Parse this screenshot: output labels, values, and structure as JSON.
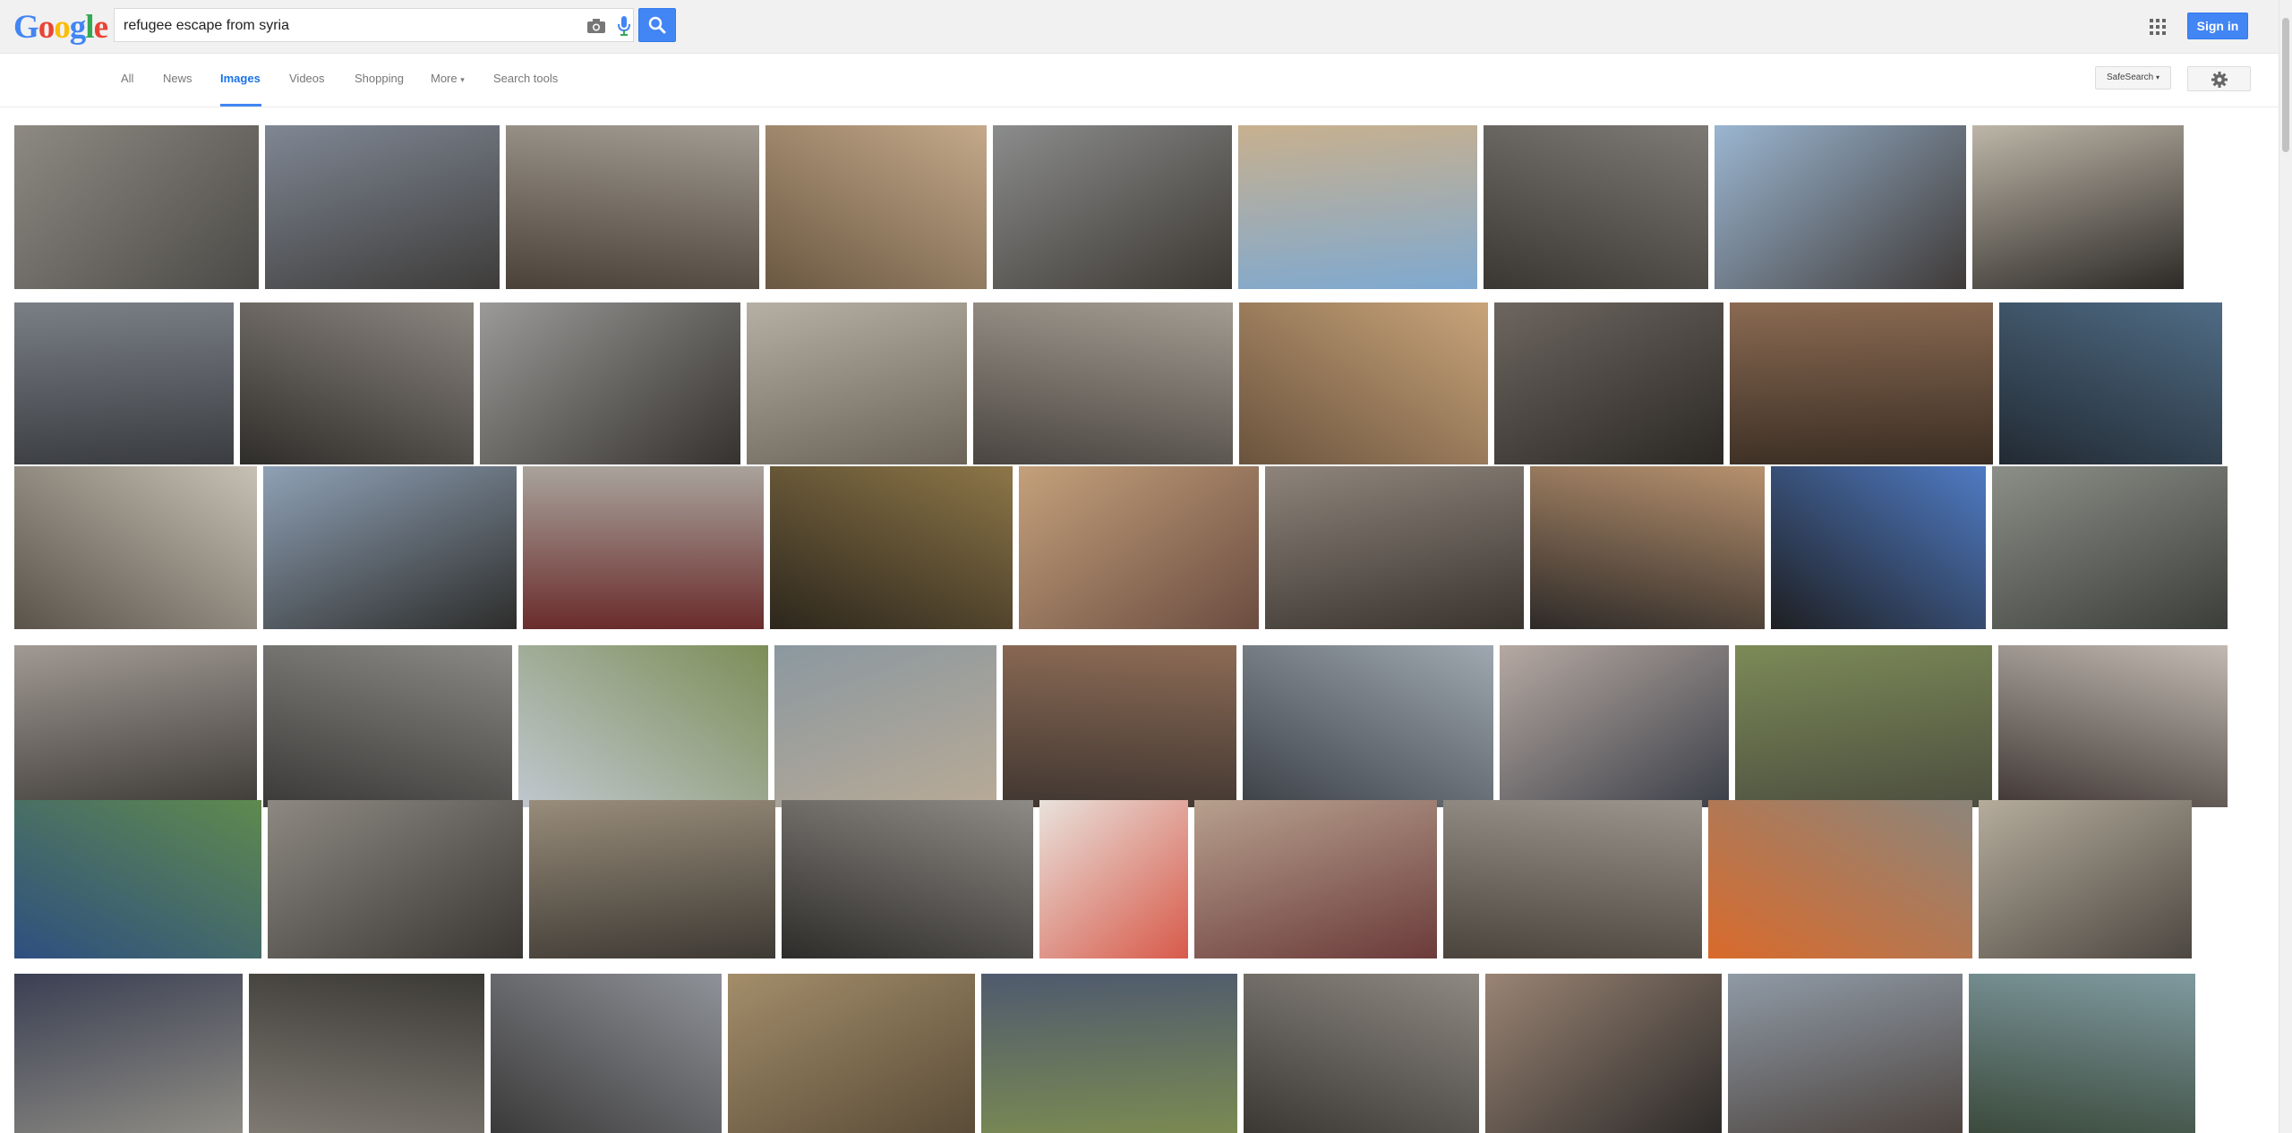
{
  "header": {
    "logo": "Google",
    "search_value": "refugee escape from syria",
    "signin_label": "Sign in"
  },
  "nav": {
    "tabs": [
      "All",
      "News",
      "Images",
      "Videos",
      "Shopping",
      "More",
      "Search tools"
    ],
    "active_tab": "Images",
    "safesearch_label": "SafeSearch"
  },
  "colors": {
    "accent": "#4285f4",
    "logo": [
      "#4285f4",
      "#ea4335",
      "#fbbc05",
      "#4285f4",
      "#34a853",
      "#ea4335"
    ]
  },
  "icons": [
    "camera-icon",
    "mic-icon",
    "search-icon",
    "apps-icon",
    "gear-icon"
  ],
  "results": {
    "rows": [
      [
        [
          "#8d8a82",
          "#4c4a47"
        ],
        [
          "#7f8794",
          "#3e3c3a"
        ],
        [
          "#a29b92",
          "#4a4138"
        ],
        [
          "#c4a98a",
          "#6b5842"
        ],
        [
          "#8b8c8c",
          "#3c3833"
        ],
        [
          "#c8b08e",
          "#7fa9d0"
        ],
        [
          "#7d7a75",
          "#3a3631"
        ],
        [
          "#9bb6d1",
          "#3f3a38"
        ],
        [
          "#bdb6a8",
          "#2d2a27"
        ]
      ],
      [
        [
          "#7a7f86",
          "#3a3c40"
        ],
        [
          "#8c8680",
          "#2f2d2a"
        ],
        [
          "#9b9a98",
          "#35322f"
        ],
        [
          "#b6b0a4",
          "#6b6357"
        ],
        [
          "#a39c92",
          "#4a4540"
        ],
        [
          "#c9a47a",
          "#6a533d"
        ],
        [
          "#6d6660",
          "#2b2825"
        ],
        [
          "#8a6a52",
          "#3b2e24"
        ],
        [
          "#4f6c85",
          "#222a33"
        ]
      ],
      [
        [
          "#c7c0b4",
          "#5a534a"
        ],
        [
          "#8fa1b6",
          "#2d2d2b"
        ],
        [
          "#a9a39c",
          "#6a2c2c"
        ],
        [
          "#8d7648",
          "#2c261c"
        ],
        [
          "#c4a07b",
          "#6b4d41"
        ],
        [
          "#8e847b",
          "#3a342f"
        ],
        [
          "#b7916e",
          "#2e2a28"
        ],
        [
          "#4f7bc4",
          "#1e1f22"
        ],
        [
          "#8c8f88",
          "#3b3e3a"
        ]
      ],
      [
        [
          "#a19a93",
          "#3e3b38"
        ],
        [
          "#8a8986",
          "#3b3937"
        ],
        [
          "#7d8e58",
          "#c0c7cf"
        ],
        [
          "#8b98a0",
          "#b8aa96"
        ],
        [
          "#8c6b55",
          "#403631"
        ],
        [
          "#9fa8b0",
          "#3c4148"
        ],
        [
          "#b6a9a2",
          "#3b3f48"
        ],
        [
          "#7c8a57",
          "#4c4e3f"
        ],
        [
          "#c2bab2",
          "#403734"
        ]
      ],
      [
        [
          "#5f8a4e",
          "#2e4f80"
        ],
        [
          "#8d8982",
          "#3a3633"
        ],
        [
          "#988c7a",
          "#3e3a34"
        ],
        [
          "#8e8b86",
          "#2e2c2a"
        ],
        [
          "#e8e2dc",
          "#d85a4a"
        ],
        [
          "#b7a08e",
          "#6b3b3a"
        ],
        [
          "#9a948c",
          "#4b443d"
        ],
        [
          "#8c867c",
          "#d96a2b"
        ],
        [
          "#b5ac9c",
          "#4c4741"
        ]
      ],
      [
        [
          "#3b3f53",
          "#8e8c84"
        ],
        [
          "#3c3a36",
          "#7e7a72"
        ],
        [
          "#8f9298",
          "#3b3a3a"
        ],
        [
          "#a38d6a",
          "#5a4c38"
        ],
        [
          "#4f5a6e",
          "#7a8a52"
        ],
        [
          "#8e8982",
          "#3b3834"
        ],
        [
          "#9a8474",
          "#2d2b2a"
        ],
        [
          "#8f9aa6",
          "#4e4540"
        ],
        [
          "#7f9aa0",
          "#3b4a3c"
        ]
      ]
    ]
  }
}
